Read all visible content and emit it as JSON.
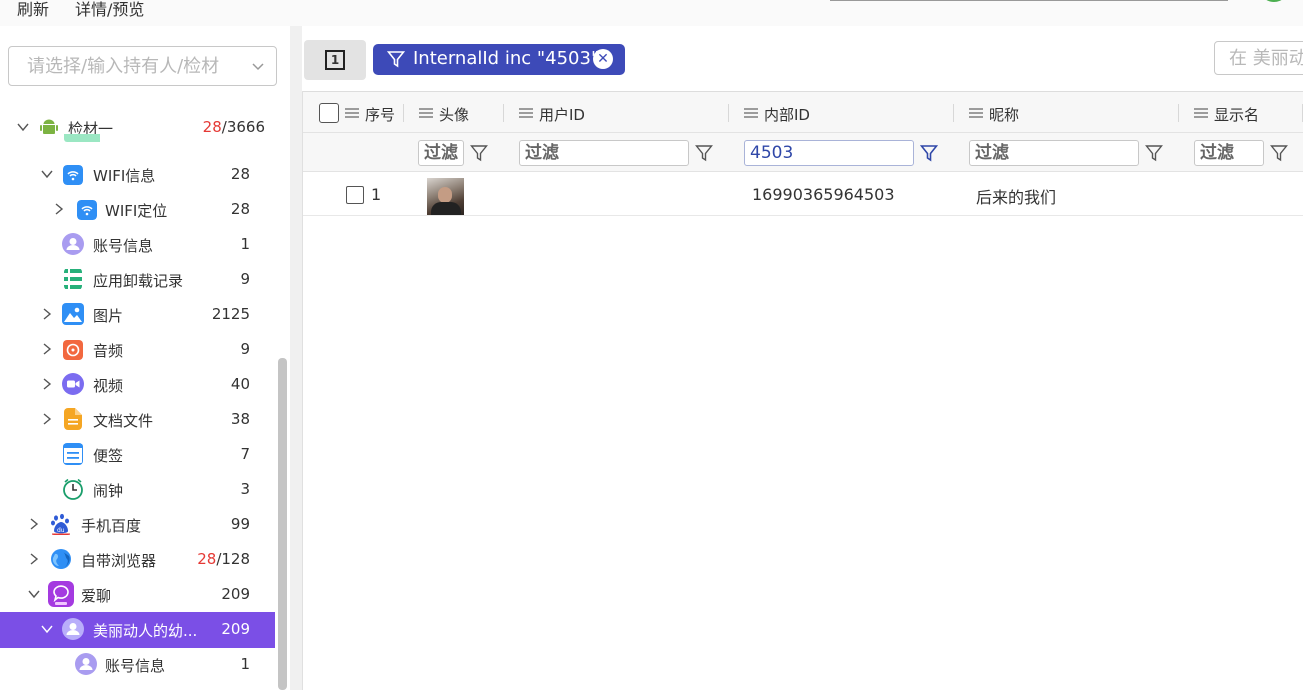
{
  "topbar": {
    "menu": [
      "刷新",
      "详情/预览"
    ]
  },
  "sidebar": {
    "search_placeholder": "请选择/输入持有人/检材",
    "tree": [
      {
        "label": "检材一",
        "count_red": "28",
        "count": "/3666",
        "icon": "android-icon",
        "expanded": true
      },
      {
        "label": "WIFI信息",
        "count": "28",
        "icon": "wifi-icon",
        "expanded": true
      },
      {
        "label": "WIFI定位",
        "count": "28",
        "icon": "wifi-icon",
        "expanded": false
      },
      {
        "label": "账号信息",
        "count": "1",
        "icon": "user-icon"
      },
      {
        "label": "应用卸载记录",
        "count": "9",
        "icon": "list-icon"
      },
      {
        "label": "图片",
        "count": "2125",
        "icon": "image-icon",
        "expanded": false
      },
      {
        "label": "音频",
        "count": "9",
        "icon": "audio-icon",
        "expanded": false
      },
      {
        "label": "视频",
        "count": "40",
        "icon": "video-icon",
        "expanded": false
      },
      {
        "label": "文档文件",
        "count": "38",
        "icon": "document-icon",
        "expanded": false
      },
      {
        "label": "便签",
        "count": "7",
        "icon": "note-icon"
      },
      {
        "label": "闹钟",
        "count": "3",
        "icon": "clock-icon"
      },
      {
        "label": "手机百度",
        "count": "99",
        "icon": "baidu-icon",
        "expanded": false
      },
      {
        "label": "自带浏览器",
        "count_red": "28",
        "count": "/128",
        "icon": "browser-icon",
        "expanded": false
      },
      {
        "label": "爱聊",
        "count": "209",
        "icon": "chat-app-icon",
        "expanded": true
      },
      {
        "label": "美丽动人的幼...",
        "count": "209",
        "icon": "user-icon",
        "expanded": true,
        "selected": true
      },
      {
        "label": "账号信息",
        "count": "1",
        "icon": "user-icon"
      }
    ]
  },
  "toolbar": {
    "filter_chip": "InternalId inc \"4503\"",
    "find_placeholder": "在 美丽动"
  },
  "grid": {
    "columns": [
      "序号",
      "头像",
      "用户ID",
      "内部ID",
      "昵称",
      "显示名"
    ],
    "filter_placeholder": "过滤",
    "filter_values": {
      "internal_id": "4503"
    },
    "rows": [
      {
        "index": "1",
        "avatar": "avatar-photo",
        "user_id": "",
        "internal_id": "16990365964503",
        "nickname": "后来的我们",
        "display_name": ""
      }
    ]
  },
  "colors": {
    "accent_selected": "#7b4fe6",
    "chip": "#3d4ab8",
    "red_count": "#e53935"
  }
}
